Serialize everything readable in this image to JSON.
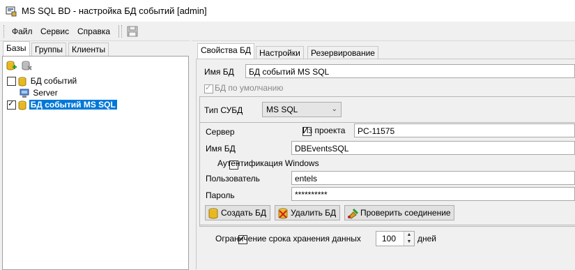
{
  "window": {
    "title": "MS SQL BD - настройка БД событий [admin]"
  },
  "menu": {
    "items": [
      "Файл",
      "Сервис",
      "Справка"
    ]
  },
  "left_tabs": [
    "Базы",
    "Группы",
    "Клиенты"
  ],
  "tree": {
    "items": [
      {
        "label": "БД событий",
        "checked": false,
        "icon": "database-icon"
      },
      {
        "label": "Server",
        "icon": "server-icon"
      },
      {
        "label": "БД событий MS SQL",
        "checked": true,
        "selected": true,
        "icon": "database-icon"
      }
    ]
  },
  "right_tabs": [
    "Свойства БД",
    "Настройки",
    "Резервирование"
  ],
  "props": {
    "db_name_label": "Имя БД",
    "db_name_value": "БД событий MS SQL",
    "default_label": "БД по умолчанию",
    "dbms_label": "Тип СУБД",
    "dbms_value": "MS SQL",
    "server_label": "Сервер",
    "from_project_label": "Из проекта",
    "server_value": "PC-11575",
    "dbname_label": "Имя БД",
    "dbname_value": "DBEventsSQL",
    "win_auth_label": "Аутентификация Windows",
    "user_label": "Пользователь",
    "user_value": "entels",
    "password_label": "Пароль",
    "password_value": "**********",
    "create_button": "Создать БД",
    "delete_button": "Удалить БД",
    "check_button": "Проверить соединение",
    "retention_label": "Ограничение срока хранения данных",
    "retention_value": "100",
    "retention_unit": "дней"
  }
}
